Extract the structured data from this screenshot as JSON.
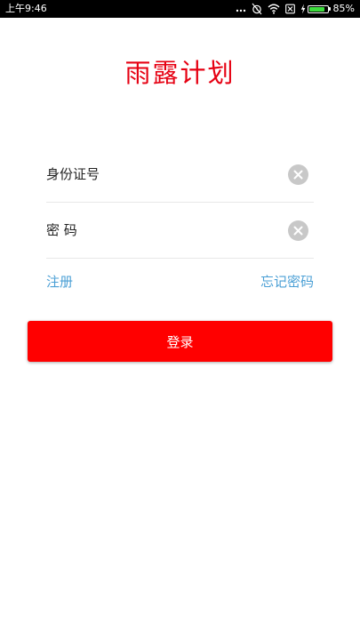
{
  "status_bar": {
    "time": "上午9:46",
    "battery_percent_text": "85%",
    "battery_level": 0.85,
    "battery_color": "#3ddc3d",
    "icons": [
      "more-dots-icon",
      "alarm-icon",
      "wifi-icon",
      "sim-card-icon",
      "charging-bolt-icon",
      "battery-icon"
    ]
  },
  "app": {
    "title": "雨露计划",
    "title_color": "#e60012"
  },
  "form": {
    "id_placeholder": "身份证号",
    "id_value": "",
    "password_placeholder": "密 码",
    "password_value": "",
    "clear_icon": "clear-icon"
  },
  "links": {
    "register": "注册",
    "forgot_password": "忘记密码",
    "link_color": "#4a9fd5"
  },
  "actions": {
    "login_label": "登录",
    "login_color": "#ff0000"
  }
}
